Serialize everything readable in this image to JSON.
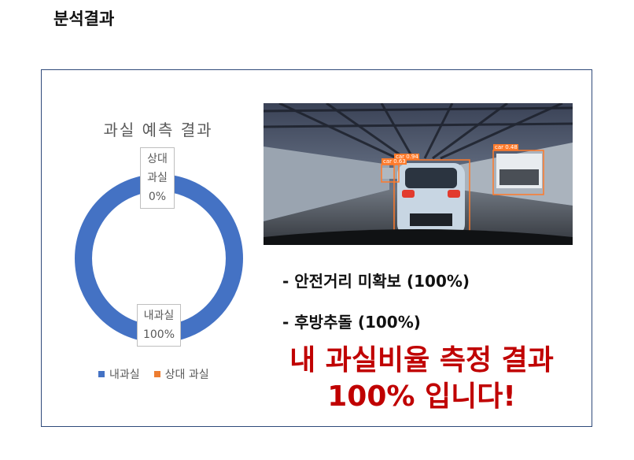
{
  "page": {
    "title": "분석결과"
  },
  "chart_data": {
    "type": "pie",
    "title": "과실 예측 결과",
    "categories": [
      "내과실",
      "상대 과실"
    ],
    "values": [
      100,
      0
    ],
    "colors": [
      "#4472c4",
      "#ed7d31"
    ],
    "data_labels": [
      {
        "lines": [
          "내과실",
          "100%"
        ]
      },
      {
        "lines": [
          "상대",
          "과실",
          "0%"
        ]
      }
    ],
    "legend": {
      "placement": "bottom",
      "entries": [
        "내과실",
        "상대 과실"
      ]
    }
  },
  "image": {
    "description_icon": "dashcam-detection-image",
    "detection_labels": [
      "car 0.94",
      "car 0.63",
      "car 0.48"
    ]
  },
  "results": {
    "items": [
      "- 안전거리 미확보 (100%)",
      "- 후방추돌 (100%)"
    ],
    "headline_line1": "내 과실비율 측정 결과",
    "headline_line2": "100% 입니다!"
  }
}
